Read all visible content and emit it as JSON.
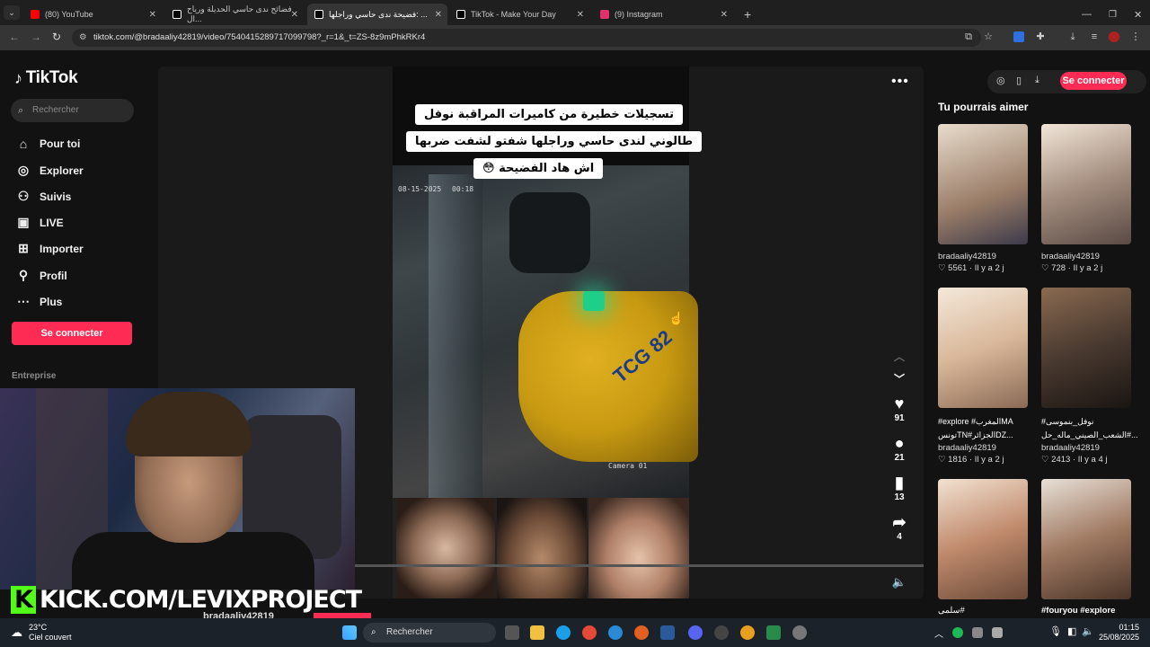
{
  "browser": {
    "tabs": [
      {
        "title": "(80) YouTube",
        "color": "#ff0000"
      },
      {
        "title": "فضائح ندى حاسي الحديلة ورياح ال...",
        "color": "#ffffff"
      },
      {
        "title": "فضيحة ندى حاسي وراجلها: ...",
        "color": "#ffffff"
      },
      {
        "title": "TikTok - Make Your Day",
        "color": "#ffffff"
      },
      {
        "title": "(9) Instagram",
        "color": "#e1306c"
      }
    ],
    "url": "tiktok.com/@bradaaliy42819/video/7540415289717099798?_r=1&_t=ZS-8z9mPhkRKr4",
    "new_tab": "+"
  },
  "sidebar": {
    "logo": "TikTok",
    "search_placeholder": "Rechercher",
    "items": [
      {
        "label": "Pour toi",
        "icon": "home-icon"
      },
      {
        "label": "Explorer",
        "icon": "compass-icon"
      },
      {
        "label": "Suivis",
        "icon": "following-icon"
      },
      {
        "label": "LIVE",
        "icon": "live-icon"
      },
      {
        "label": "Importer",
        "icon": "upload-icon"
      },
      {
        "label": "Profil",
        "icon": "profile-icon"
      },
      {
        "label": "Plus",
        "icon": "more-icon"
      }
    ],
    "login": "Se connecter",
    "section": "Entreprise"
  },
  "video": {
    "caption_lines": [
      "تسجيلات خطيرة من كاميرات المراقبة نوفل",
      "طالوني لندى حاسي وراجلها شفتو لشفت ضربها",
      "اش هاد الفضيحة 😳"
    ],
    "cam_date": "08-15-2025",
    "cam_time": "00:18",
    "cam_label": "Camera 01",
    "taxi_plate": "TCG 82",
    "likes": "91",
    "comments": "21",
    "saves": "13",
    "shares": "4",
    "username_peek": "bradaaliy42819"
  },
  "right": {
    "login": "Se connecter",
    "title": "Tu pourrais aimer",
    "items": [
      {
        "caption": "",
        "user": "bradaaliy42819",
        "likes": "5561",
        "age": "Il y a 2 j",
        "color": "#c9b6a8"
      },
      {
        "caption": "",
        "user": "bradaaliy42819",
        "likes": "728",
        "age": "Il y a 2 j",
        "color": "#8c7d78"
      },
      {
        "caption": "#explore #المغربMA تونسTN#الجزائرDZ...",
        "user": "bradaaliy42819",
        "likes": "1816",
        "age": "Il y a 2 j",
        "color": "#d7c4b0"
      },
      {
        "caption": "نوفل_بنموسى# الشعب_الصيني_ماله_حل#...",
        "user": "bradaaliy42819",
        "likes": "2413",
        "age": "Il y a 4 j",
        "color": "#6b5a4a"
      },
      {
        "caption": "سلمى#",
        "user": "",
        "likes": "",
        "age": "",
        "color": "#b88a70"
      },
      {
        "caption": "#fouryou #explore",
        "user": "",
        "likes": "",
        "age": "",
        "color": "#9c7f6a"
      }
    ]
  },
  "stream": {
    "brand": "K",
    "url": "KICK.COM/LEVIXPROJECT"
  },
  "taskbar": {
    "temp": "23°C",
    "weather": "Ciel couvert",
    "search": "Rechercher",
    "time": "01:15",
    "date": "25/08/2025"
  }
}
